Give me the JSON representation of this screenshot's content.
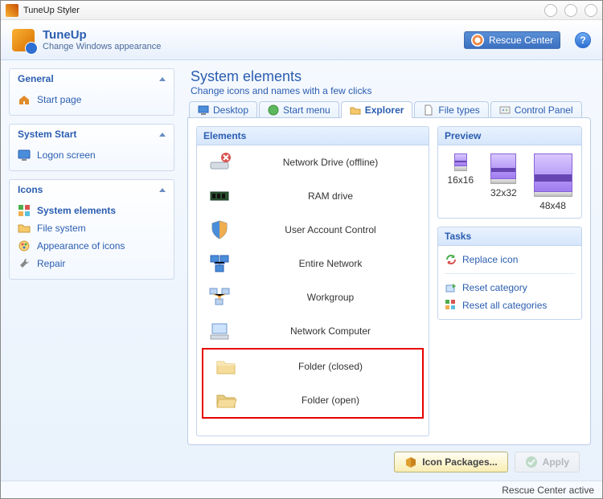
{
  "window": {
    "title": "TuneUp Styler"
  },
  "header": {
    "brand": "TuneUp",
    "subtitle": "Change Windows appearance",
    "rescue_label": "Rescue Center"
  },
  "sidebar": {
    "panels": [
      {
        "title": "General",
        "items": [
          {
            "label": "Start page",
            "icon": "home-icon"
          }
        ]
      },
      {
        "title": "System Start",
        "items": [
          {
            "label": "Logon screen",
            "icon": "monitor-icon"
          }
        ]
      },
      {
        "title": "Icons",
        "items": [
          {
            "label": "System elements",
            "icon": "elements-icon",
            "active": true
          },
          {
            "label": "File system",
            "icon": "folder-icon"
          },
          {
            "label": "Appearance of icons",
            "icon": "appearance-icon"
          },
          {
            "label": "Repair",
            "icon": "repair-icon"
          }
        ]
      }
    ]
  },
  "page": {
    "title": "System elements",
    "subtitle": "Change icons and names with a few clicks"
  },
  "tabs": [
    {
      "label": "Desktop",
      "icon": "desktop-icon"
    },
    {
      "label": "Start menu",
      "icon": "start-icon"
    },
    {
      "label": "Explorer",
      "icon": "explorer-icon",
      "active": true
    },
    {
      "label": "File types",
      "icon": "filetypes-icon"
    },
    {
      "label": "Control Panel",
      "icon": "controlpanel-icon"
    }
  ],
  "elements_section": {
    "title": "Elements",
    "items": [
      {
        "label": "Network Drive (offline)",
        "icon": "netdrive-offline-icon"
      },
      {
        "label": "RAM drive",
        "icon": "ram-icon"
      },
      {
        "label": "User Account Control",
        "icon": "shield-icon"
      },
      {
        "label": "Entire Network",
        "icon": "entire-network-icon"
      },
      {
        "label": "Workgroup",
        "icon": "workgroup-icon"
      },
      {
        "label": "Network Computer",
        "icon": "network-computer-icon"
      },
      {
        "label": "Folder (closed)",
        "icon": "folder-closed-icon",
        "highlighted": true
      },
      {
        "label": "Folder (open)",
        "icon": "folder-open-icon",
        "highlighted": true
      }
    ]
  },
  "preview_section": {
    "title": "Preview",
    "sizes": [
      "16x16",
      "32x32",
      "48x48"
    ]
  },
  "tasks_section": {
    "title": "Tasks",
    "links": {
      "replace": "Replace icon",
      "reset_category": "Reset category",
      "reset_all": "Reset all categories"
    }
  },
  "buttons": {
    "icon_packages": "Icon Packages...",
    "apply": "Apply"
  },
  "status": {
    "text": "Rescue Center active"
  }
}
